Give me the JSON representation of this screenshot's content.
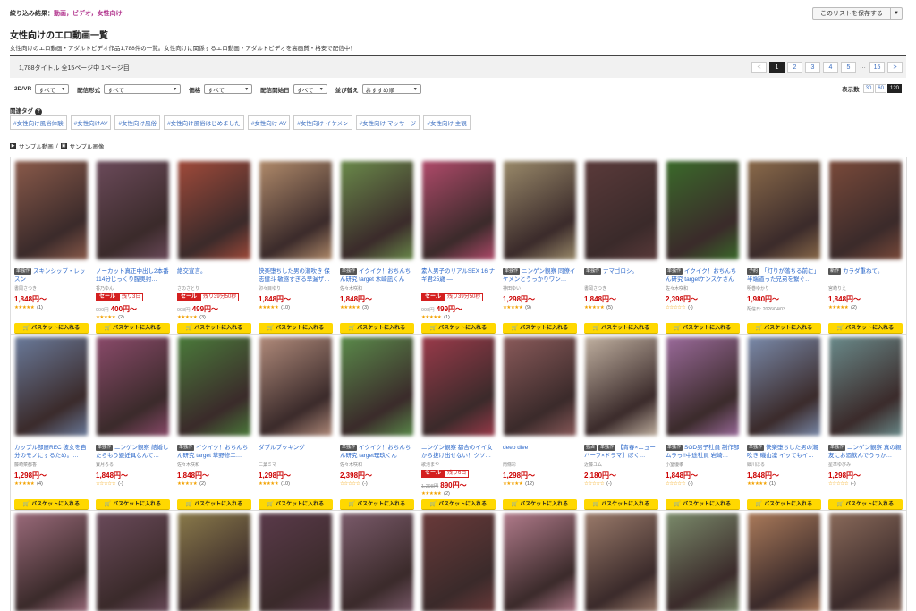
{
  "filter": {
    "prefix": "絞り込み結果：",
    "value": "動画，ビデオ，女性向け"
  },
  "save_button": "このリストを保存する",
  "title": "女性向けのエロ動画一覧",
  "description": "女性向けのエロ動画・アダルトビデオ作品1,788件の一覧。女性向けに関係するエロ動画・アダルトビデオを高画質・格安で配信中！",
  "count_text": "1,788タイトル 全15ページ中 1ページ目",
  "pagination": {
    "prev": "<",
    "pages": [
      "1",
      "2",
      "3",
      "4",
      "5"
    ],
    "ellipsis": "…",
    "last": "15",
    "next": ">",
    "current": "1"
  },
  "filters": [
    {
      "label": "2D/VR",
      "value": "すべて",
      "w": 38
    },
    {
      "label": "配信形式",
      "value": "すべて",
      "w": 86
    },
    {
      "label": "価格",
      "value": "すべて",
      "w": 54
    },
    {
      "label": "配信開始日",
      "value": "すべて",
      "w": 38
    },
    {
      "label": "並び替え",
      "value": "おすすめ順",
      "w": 66
    }
  ],
  "display": {
    "label": "表示数",
    "options": [
      "30",
      "60",
      "120"
    ],
    "selected": "120"
  },
  "related_tags_title": "関連タグ",
  "related_tags": [
    "#女性向け風俗体験",
    "#女性向けAV",
    "#女性向け風俗",
    "#女性向け風俗はじめました",
    "#女性向け AV",
    "#女性向け イケメン",
    "#女性向け マッサージ",
    "#女性向け 主観"
  ],
  "legend": {
    "video": "サンプル動画",
    "sep": "/",
    "image": "サンプル画像"
  },
  "cart_label": "バスケットに入れる",
  "products": [
    {
      "badge": "単独作",
      "title": "スキンシップ・レッスン",
      "actress": "書岡さつき",
      "price": "1,848円〜",
      "rating": 5,
      "reviews": "(1)",
      "color": "#8a5a4a"
    },
    {
      "badge": "",
      "title": "ノーカット真正中出し2本番 114分じっくり膣奥射…",
      "actress": "香乃ゆん",
      "sale": "セール",
      "remain": "残り3日",
      "old": "900円",
      "price": "400円〜",
      "rating": 5,
      "reviews": "(2)",
      "color": "#6b4a5a"
    },
    {
      "badge": "",
      "title": "絶交宣言。",
      "actress": "さのさとり",
      "sale": "セール",
      "remain": "残り39分50秒",
      "old": "998円",
      "price": "499円〜",
      "rating": 5,
      "reviews": "(3)",
      "color": "#a04a3a"
    },
    {
      "badge": "",
      "title": "快楽堕ちした男の潮吹き 保志健斗 敏感すぎる早漏ザ…",
      "actress": "卯々目ゆり",
      "price": "1,848円〜",
      "rating": 5,
      "reviews": "(10)",
      "color": "#b08a6a"
    },
    {
      "badge": "単独作",
      "title": "イクイク！おちんちん研究 target 木崎凪くん",
      "actress": "佐々木咲和",
      "price": "1,848円〜",
      "rating": 5,
      "reviews": "(3)",
      "color": "#6a8a4a"
    },
    {
      "badge": "",
      "title": "素人男子のリアルSEX 16 ナギ君25歳 —",
      "actress": "",
      "sale": "セール",
      "remain": "残り39分50秒",
      "old": "998円",
      "price": "499円〜",
      "rating": 5,
      "reviews": "(1)",
      "color": "#b04a6a"
    },
    {
      "badge": "単独作",
      "title": "ニンゲン観察 同僚イケメンとうっかりワン…",
      "actress": "神田ゆい",
      "price": "1,298円〜",
      "rating": 5,
      "reviews": "(9)",
      "color": "#9a8a6a"
    },
    {
      "badge": "単独作",
      "title": "ナマゴロシ。",
      "actress": "書岡さつき",
      "price": "1,848円〜",
      "rating": 5,
      "reviews": "(5)",
      "color": "#5a3a3a"
    },
    {
      "badge": "単独作",
      "title": "イクイク！おちんちん研究 targetケンスケさん",
      "actress": "佐々木咲和",
      "price": "2,398円〜",
      "rating": 0,
      "reviews": "(-)",
      "color": "#3a6a2a"
    },
    {
      "badge": "予約",
      "title": "「灯りが落ちる前に」半端道った兄弟を繋ぐ…",
      "actress": "明巻ゆかり",
      "price": "1,980円〜",
      "release": "配信日: 2026/04/03",
      "rating": -1,
      "reviews": "",
      "color": "#8a6a4a"
    },
    {
      "badge": "新作",
      "title": "カラダ重ねて。",
      "actress": "宮崎りえ",
      "price": "1,848円〜",
      "rating": 5,
      "reviews": "(2)",
      "color": "#7a4a3a"
    },
    {
      "badge": "",
      "title": "カップル部屋REC 彼女を自分のモノにするため。…",
      "actress": "藤崎菜都香",
      "price": "1,298円〜",
      "rating": 5,
      "reviews": "(4)",
      "color": "#6a7a9a"
    },
    {
      "badge": "単独作",
      "title": "ニンゲン観察 結婚したらもう避妊具なんて…",
      "actress": "寶月ろる",
      "price": "1,848円〜",
      "rating": 0,
      "reviews": "(-)",
      "color": "#8a4a6a"
    },
    {
      "badge": "単独作",
      "title": "イクイク！おちんちん研究 target 草野修二…",
      "actress": "佐々木咲和",
      "price": "1,848円〜",
      "rating": 5,
      "reviews": "(2)",
      "color": "#4a7a3a"
    },
    {
      "badge": "",
      "title": "ダブルブッキング",
      "actress": "二葉ミマ",
      "price": "1,298円〜",
      "rating": 5,
      "reviews": "(10)",
      "color": "#b08a7a"
    },
    {
      "badge": "単独作",
      "title": "イクイク！おちんちん研究 target理玖くん",
      "actress": "佐々木咲和",
      "price": "2,398円〜",
      "rating": 0,
      "reviews": "(-)",
      "color": "#5a8a4a"
    },
    {
      "badge": "",
      "title": "ニンゲン観察 都合のイイ女から抜け出せない！クソ…",
      "actress": "歌池まや",
      "sale": "セール",
      "remain": "残り6日",
      "old": "1,298円",
      "price": "890円〜",
      "rating": 5,
      "reviews": "(2)",
      "color": "#9a3a4a"
    },
    {
      "badge": "",
      "title": "deep dive",
      "actress": "南條彩",
      "price": "1,298円〜",
      "rating": 5,
      "reviews": "(12)",
      "color": "#8a5a5a"
    },
    {
      "badge": "独占",
      "badge2": "単独作",
      "title": "【青春×ニューハーフ×ドラマ】ぼく…",
      "actress": "近藤ユム",
      "price": "2,180円〜",
      "rating": 0,
      "reviews": "(-)",
      "color": "#c0b0a0"
    },
    {
      "badge": "単独作",
      "title": "SOD男子社員 制作部 ムラっ!!中途社員 岩崎…",
      "actress": "小室優孝",
      "price": "1,848円〜",
      "rating": 0,
      "reviews": "(-)",
      "color": "#9a6a9a"
    },
    {
      "badge": "単独作",
      "title": "快楽堕ちした男の潮吹き 磯山凜 イッてもイ…",
      "actress": "細川ほる",
      "price": "1,848円〜",
      "rating": 5,
      "reviews": "(1)",
      "color": "#7a8aaa"
    },
    {
      "badge": "単独作",
      "title": "ニンゲン観察 真の親友にお酒飲んでうっか…",
      "actress": "星準ゆびみ",
      "price": "1,298円〜",
      "rating": 0,
      "reviews": "(-)",
      "color": "#6a8a8a"
    }
  ],
  "row3_colors": [
    "#9a6a7a",
    "#6a4a5a",
    "#8a7a4a",
    "#5a3a4a",
    "#7a5a6a",
    "#6a3a3a",
    "#b07a8a",
    "#9a7a6a",
    "#7a8a6a",
    "#aa7a5a",
    "#8a6a5a"
  ]
}
